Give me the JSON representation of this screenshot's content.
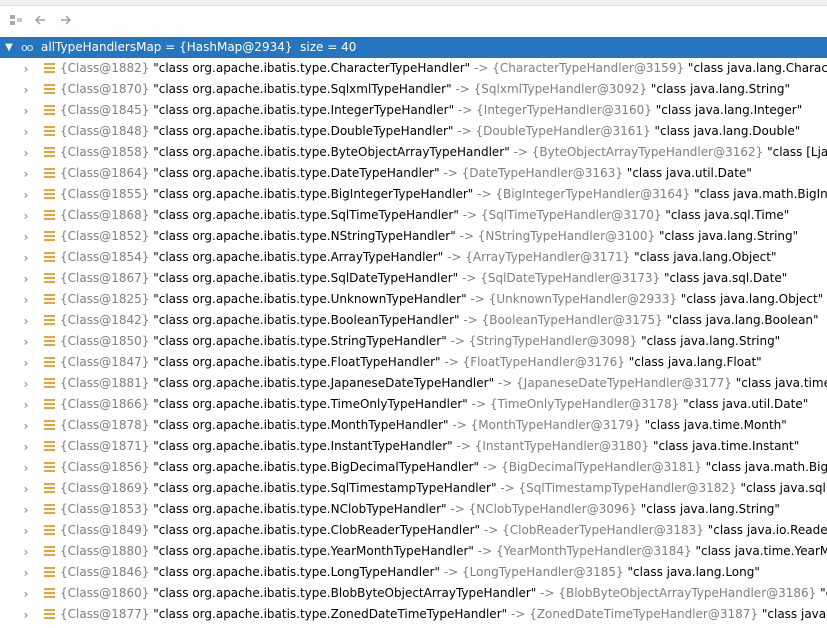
{
  "colors": {
    "selection": "#2675bf",
    "field_icon": "#e8a33d",
    "ref_gray": "#7f7f7f"
  },
  "toolbar": {
    "icons": [
      "restore-layout-icon",
      "back-arrow-icon",
      "forward-arrow-icon"
    ]
  },
  "root": {
    "name": "allTypeHandlersMap",
    "ref": "{HashMap@2934}",
    "size": "size = 40"
  },
  "rows": [
    {
      "key_ref": "{Class@1882}",
      "key_val": "\"class org.apache.ibatis.type.CharacterTypeHandler\"",
      "val_ref": "{CharacterTypeHandler@3159}",
      "val": "\"class java.lang.Character\""
    },
    {
      "key_ref": "{Class@1870}",
      "key_val": "\"class org.apache.ibatis.type.SqlxmlTypeHandler\"",
      "val_ref": "{SqlxmlTypeHandler@3092}",
      "val": "\"class java.lang.String\""
    },
    {
      "key_ref": "{Class@1845}",
      "key_val": "\"class org.apache.ibatis.type.IntegerTypeHandler\"",
      "val_ref": "{IntegerTypeHandler@3160}",
      "val": "\"class java.lang.Integer\""
    },
    {
      "key_ref": "{Class@1848}",
      "key_val": "\"class org.apache.ibatis.type.DoubleTypeHandler\"",
      "val_ref": "{DoubleTypeHandler@3161}",
      "val": "\"class java.lang.Double\""
    },
    {
      "key_ref": "{Class@1858}",
      "key_val": "\"class org.apache.ibatis.type.ByteObjectArrayTypeHandler\"",
      "val_ref": "{ByteObjectArrayTypeHandler@3162}",
      "val": "\"class [Ljava.lang."
    },
    {
      "key_ref": "{Class@1864}",
      "key_val": "\"class org.apache.ibatis.type.DateTypeHandler\"",
      "val_ref": "{DateTypeHandler@3163}",
      "val": "\"class java.util.Date\""
    },
    {
      "key_ref": "{Class@1855}",
      "key_val": "\"class org.apache.ibatis.type.BigIntegerTypeHandler\"",
      "val_ref": "{BigIntegerTypeHandler@3164}",
      "val": "\"class java.math.BigInteger\""
    },
    {
      "key_ref": "{Class@1868}",
      "key_val": "\"class org.apache.ibatis.type.SqlTimeTypeHandler\"",
      "val_ref": "{SqlTimeTypeHandler@3170}",
      "val": "\"class java.sql.Time\""
    },
    {
      "key_ref": "{Class@1852}",
      "key_val": "\"class org.apache.ibatis.type.NStringTypeHandler\"",
      "val_ref": "{NStringTypeHandler@3100}",
      "val": "\"class java.lang.String\""
    },
    {
      "key_ref": "{Class@1854}",
      "key_val": "\"class org.apache.ibatis.type.ArrayTypeHandler\"",
      "val_ref": "{ArrayTypeHandler@3171}",
      "val": "\"class java.lang.Object\""
    },
    {
      "key_ref": "{Class@1867}",
      "key_val": "\"class org.apache.ibatis.type.SqlDateTypeHandler\"",
      "val_ref": "{SqlDateTypeHandler@3173}",
      "val": "\"class java.sql.Date\""
    },
    {
      "key_ref": "{Class@1825}",
      "key_val": "\"class org.apache.ibatis.type.UnknownTypeHandler\"",
      "val_ref": "{UnknownTypeHandler@2933}",
      "val": "\"class java.lang.Object\""
    },
    {
      "key_ref": "{Class@1842}",
      "key_val": "\"class org.apache.ibatis.type.BooleanTypeHandler\"",
      "val_ref": "{BooleanTypeHandler@3175}",
      "val": "\"class java.lang.Boolean\""
    },
    {
      "key_ref": "{Class@1850}",
      "key_val": "\"class org.apache.ibatis.type.StringTypeHandler\"",
      "val_ref": "{StringTypeHandler@3098}",
      "val": "\"class java.lang.String\""
    },
    {
      "key_ref": "{Class@1847}",
      "key_val": "\"class org.apache.ibatis.type.FloatTypeHandler\"",
      "val_ref": "{FloatTypeHandler@3176}",
      "val": "\"class java.lang.Float\""
    },
    {
      "key_ref": "{Class@1881}",
      "key_val": "\"class org.apache.ibatis.type.JapaneseDateTypeHandler\"",
      "val_ref": "{JapaneseDateTypeHandler@3177}",
      "val": "\"class java.time.chrono"
    },
    {
      "key_ref": "{Class@1866}",
      "key_val": "\"class org.apache.ibatis.type.TimeOnlyTypeHandler\"",
      "val_ref": "{TimeOnlyTypeHandler@3178}",
      "val": "\"class java.util.Date\""
    },
    {
      "key_ref": "{Class@1878}",
      "key_val": "\"class org.apache.ibatis.type.MonthTypeHandler\"",
      "val_ref": "{MonthTypeHandler@3179}",
      "val": "\"class java.time.Month\""
    },
    {
      "key_ref": "{Class@1871}",
      "key_val": "\"class org.apache.ibatis.type.InstantTypeHandler\"",
      "val_ref": "{InstantTypeHandler@3180}",
      "val": "\"class java.time.Instant\""
    },
    {
      "key_ref": "{Class@1856}",
      "key_val": "\"class org.apache.ibatis.type.BigDecimalTypeHandler\"",
      "val_ref": "{BigDecimalTypeHandler@3181}",
      "val": "\"class java.math.BigDecimal"
    },
    {
      "key_ref": "{Class@1869}",
      "key_val": "\"class org.apache.ibatis.type.SqlTimestampTypeHandler\"",
      "val_ref": "{SqlTimestampTypeHandler@3182}",
      "val": "\"class java.sql.Timesta"
    },
    {
      "key_ref": "{Class@1853}",
      "key_val": "\"class org.apache.ibatis.type.NClobTypeHandler\"",
      "val_ref": "{NClobTypeHandler@3096}",
      "val": "\"class java.lang.String\""
    },
    {
      "key_ref": "{Class@1849}",
      "key_val": "\"class org.apache.ibatis.type.ClobReaderTypeHandler\"",
      "val_ref": "{ClobReaderTypeHandler@3183}",
      "val": "\"class java.io.Reader\""
    },
    {
      "key_ref": "{Class@1880}",
      "key_val": "\"class org.apache.ibatis.type.YearMonthTypeHandler\"",
      "val_ref": "{YearMonthTypeHandler@3184}",
      "val": "\"class java.time.YearMonth\""
    },
    {
      "key_ref": "{Class@1846}",
      "key_val": "\"class org.apache.ibatis.type.LongTypeHandler\"",
      "val_ref": "{LongTypeHandler@3185}",
      "val": "\"class java.lang.Long\""
    },
    {
      "key_ref": "{Class@1860}",
      "key_val": "\"class org.apache.ibatis.type.BlobByteObjectArrayTypeHandler\"",
      "val_ref": "{BlobByteObjectArrayTypeHandler@3186}",
      "val": "\"class [Lj"
    },
    {
      "key_ref": "{Class@1877}",
      "key_val": "\"class org.apache.ibatis.type.ZonedDateTimeTypeHandler\"",
      "val_ref": "{ZonedDateTimeTypeHandler@3187}",
      "val": "\"class java.time.Zo"
    }
  ]
}
